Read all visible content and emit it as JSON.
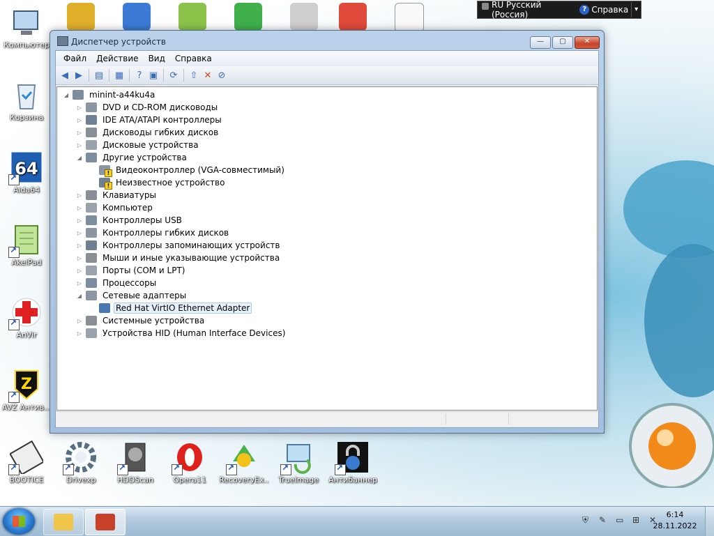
{
  "langbar": {
    "lang": "RU Русский (Россия)",
    "help": "Справка",
    "opt": "▾"
  },
  "window": {
    "title": "Диспетчер устройств",
    "controls": {
      "min": "—",
      "max": "▢",
      "close": "✕"
    }
  },
  "menu": [
    "Файл",
    "Действие",
    "Вид",
    "Справка"
  ],
  "tree": {
    "root": "minint-a44ku4a",
    "items": [
      {
        "label": "DVD и CD-ROM дисководы",
        "level": 1,
        "exp": "▷"
      },
      {
        "label": "IDE ATA/ATAPI контроллеры",
        "level": 1,
        "exp": "▷"
      },
      {
        "label": "Дисководы гибких дисков",
        "level": 1,
        "exp": "▷"
      },
      {
        "label": "Дисковые устройства",
        "level": 1,
        "exp": "▷"
      },
      {
        "label": "Другие устройства",
        "level": 1,
        "exp": "◢"
      },
      {
        "label": "Видеоконтроллер (VGA-совместимый)",
        "level": 2,
        "warn": true
      },
      {
        "label": "Неизвестное устройство",
        "level": 2,
        "warn": true
      },
      {
        "label": "Клавиатуры",
        "level": 1,
        "exp": "▷"
      },
      {
        "label": "Компьютер",
        "level": 1,
        "exp": "▷"
      },
      {
        "label": "Контроллеры USB",
        "level": 1,
        "exp": "▷"
      },
      {
        "label": "Контроллеры гибких дисков",
        "level": 1,
        "exp": "▷"
      },
      {
        "label": "Контроллеры запоминающих устройств",
        "level": 1,
        "exp": "▷"
      },
      {
        "label": "Мыши и иные указывающие устройства",
        "level": 1,
        "exp": "▷"
      },
      {
        "label": "Порты (COM и LPT)",
        "level": 1,
        "exp": "▷"
      },
      {
        "label": "Процессоры",
        "level": 1,
        "exp": "▷"
      },
      {
        "label": "Сетевые адаптеры",
        "level": 1,
        "exp": "◢"
      },
      {
        "label": "Red Hat VirtIO Ethernet Adapter",
        "level": 2,
        "selected": true
      },
      {
        "label": "Системные устройства",
        "level": 1,
        "exp": "▷"
      },
      {
        "label": "Устройства HID (Human Interface Devices)",
        "level": 1,
        "exp": "▷"
      }
    ]
  },
  "desktop_left": [
    "Компьютер",
    "Корзина",
    "Aida64",
    "AkelPad",
    "AnVir",
    "AVZ Антив..."
  ],
  "desktop_bottom": [
    "BOOTICE",
    "Drivexp",
    "HDDScan",
    "Opera11",
    "RecoveryEx...",
    "TrueImage",
    "Антибаннер"
  ],
  "clock": {
    "time": "6:14",
    "date": "28.11.2022"
  },
  "colors": {
    "accent": "#2a63c8",
    "selection": "#e8f2fd",
    "warning": "#f7d21d"
  }
}
